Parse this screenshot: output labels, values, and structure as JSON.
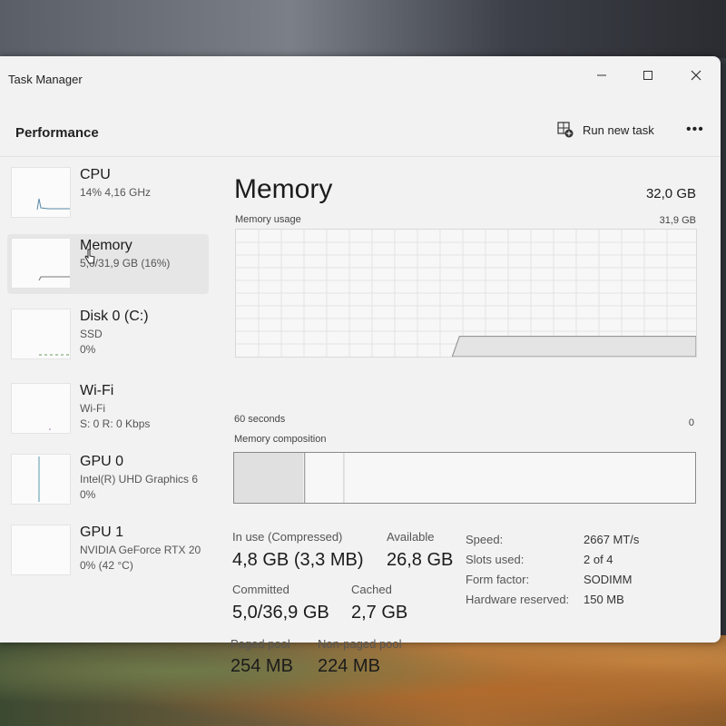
{
  "window": {
    "title": "Task Manager"
  },
  "toolbar": {
    "section": "Performance",
    "run_new_task": "Run new task"
  },
  "sidebar": {
    "items": [
      {
        "name": "CPU",
        "line1": "14% 4,16 GHz",
        "line2": ""
      },
      {
        "name": "Memory",
        "line1": "5,0/31,9 GB (16%)",
        "line2": ""
      },
      {
        "name": "Disk 0 (C:)",
        "line1": "SSD",
        "line2": "0%"
      },
      {
        "name": "Wi-Fi",
        "line1": "Wi-Fi",
        "line2": "S: 0 R: 0 Kbps"
      },
      {
        "name": "GPU 0",
        "line1": "Intel(R) UHD Graphics 6",
        "line2": "0%"
      },
      {
        "name": "GPU 1",
        "line1": "NVIDIA GeForce RTX 20",
        "line2": "0% (42 °C)"
      }
    ]
  },
  "main": {
    "title": "Memory",
    "total": "32,0 GB",
    "usage_label": "Memory usage",
    "usage_max": "31,9 GB",
    "time_label": "60 seconds",
    "zero_label": "0",
    "composition_label": "Memory composition",
    "stats": {
      "in_use_label": "In use (Compressed)",
      "in_use_value": "4,8 GB (3,3 MB)",
      "available_label": "Available",
      "available_value": "26,8 GB",
      "committed_label": "Committed",
      "committed_value": "5,0/36,9 GB",
      "cached_label": "Cached",
      "cached_value": "2,7 GB",
      "paged_label": "Paged pool",
      "paged_value": "254 MB",
      "nonpaged_label": "Non-paged pool",
      "nonpaged_value": "224 MB"
    },
    "properties": {
      "speed_label": "Speed:",
      "speed_value": "2667 MT/s",
      "slots_label": "Slots used:",
      "slots_value": "2 of 4",
      "form_label": "Form factor:",
      "form_value": "SODIMM",
      "reserved_label": "Hardware reserved:",
      "reserved_value": "150 MB"
    },
    "usage_fraction": 0.16,
    "composition": {
      "in_use_fraction": 0.15,
      "modified_fraction": 0.003,
      "standby_fraction": 0.085
    }
  },
  "colors": {
    "window_bg": "#f2f2f2",
    "graph_fill": "#e4e4e4",
    "graph_line": "#8a8a8a",
    "selected_bg": "#e6e6e6"
  },
  "icons": {
    "minimize": "minimize-icon",
    "maximize": "maximize-icon",
    "close": "close-icon",
    "run_task": "run-task-icon",
    "more": "more-icon"
  }
}
